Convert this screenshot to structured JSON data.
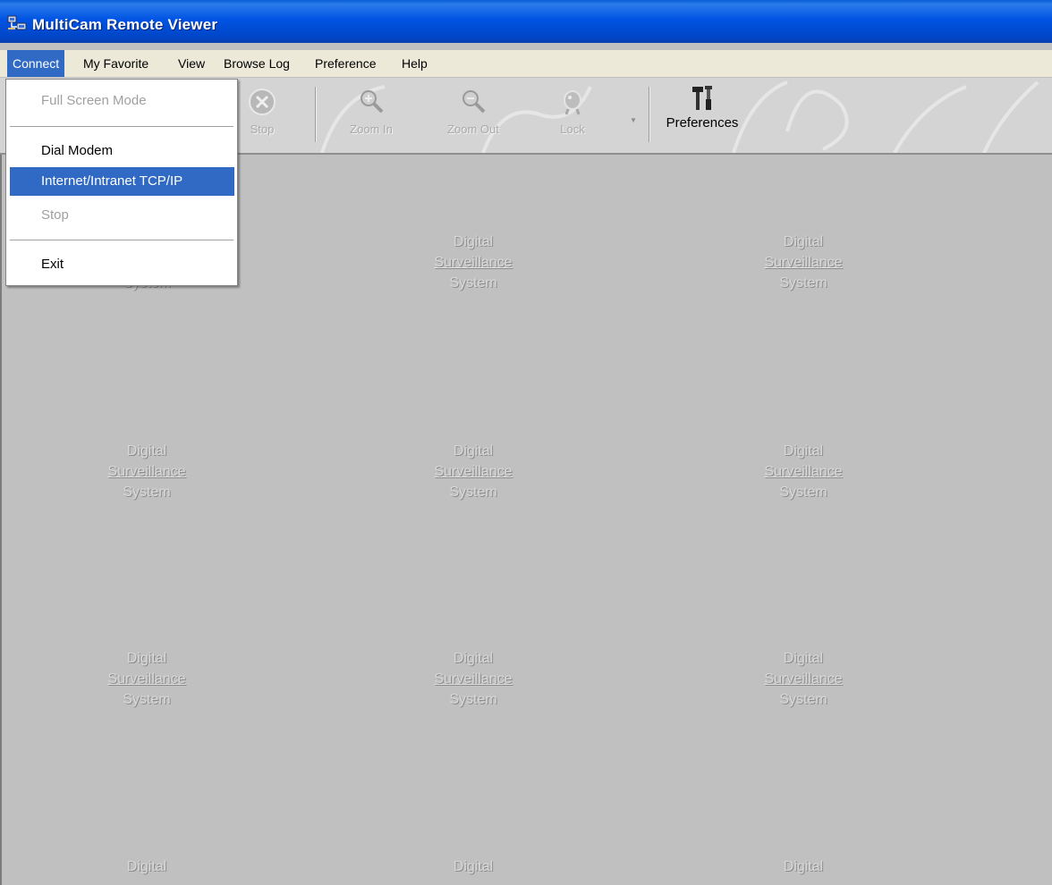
{
  "window": {
    "title": "MultiCam Remote Viewer",
    "icon": "network-computers-icon"
  },
  "menubar": {
    "items": [
      {
        "label": "Connect",
        "active": true
      },
      {
        "label": "My Favorite"
      },
      {
        "label": "View"
      },
      {
        "label": "Browse Log"
      },
      {
        "label": "Preference"
      },
      {
        "label": "Help"
      }
    ]
  },
  "toolbar": {
    "buttons": [
      {
        "label": "Stop",
        "icon": "stop-icon",
        "enabled": false
      },
      {
        "label": "Zoom In",
        "icon": "zoom-in-icon",
        "enabled": false
      },
      {
        "label": "Zoom Out",
        "icon": "zoom-out-icon",
        "enabled": false
      },
      {
        "label": "Lock",
        "icon": "lock-icon",
        "enabled": false
      },
      {
        "label": "Preferences",
        "icon": "tools-icon",
        "enabled": true
      }
    ]
  },
  "connect_menu": {
    "items": [
      {
        "label": "Full Screen Mode",
        "enabled": false
      },
      {
        "label": "Dial Modem",
        "enabled": true
      },
      {
        "label": "Internet/Intranet TCP/IP",
        "enabled": true,
        "selected": true
      },
      {
        "label": "Stop",
        "enabled": false
      },
      {
        "label": "Exit",
        "enabled": true
      }
    ]
  },
  "camera_placeholder": {
    "line1": "Digital",
    "line2": "Surveillance",
    "line3": "System"
  },
  "colors": {
    "titlebar": "#0054e3",
    "selection": "#316ac5",
    "viewport": "#c0c0c0",
    "menubar": "#ece9d8"
  }
}
